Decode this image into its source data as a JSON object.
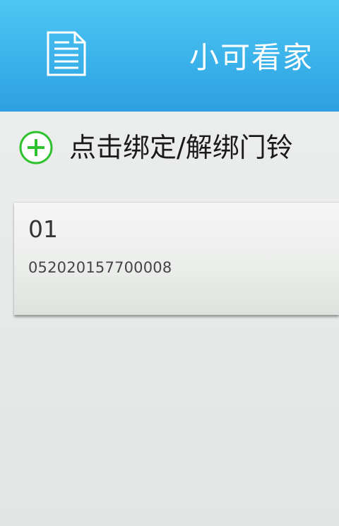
{
  "header": {
    "title": "小可看家",
    "icon": "document-icon",
    "background_color": "#3ab2ea"
  },
  "bind_action": {
    "icon": "plus-circle-icon",
    "icon_color": "#2ec22e",
    "label": "点击绑定/解绑门铃"
  },
  "devices": [
    {
      "name": "01",
      "id": "052020157700008"
    }
  ]
}
